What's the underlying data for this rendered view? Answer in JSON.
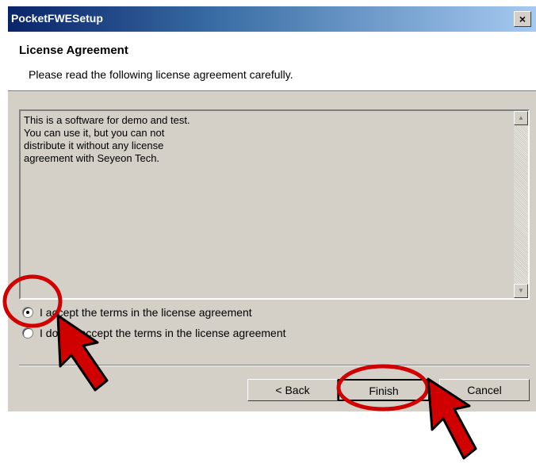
{
  "window": {
    "title": "PocketFWESetup",
    "close_glyph": "×"
  },
  "header": {
    "title": "License Agreement",
    "subtitle": "Please read the following license agreement carefully."
  },
  "license": {
    "text": "This is a software for demo and test.\nYou can use it, but you can not\ndistribute it without any license\nagreement with Seyeon Tech.",
    "scroll_up_glyph": "▲",
    "scroll_down_glyph": "▼"
  },
  "options": [
    {
      "label": "I accept the terms in the license agreement",
      "checked": true
    },
    {
      "label": "I do not accept the terms in the license agreement",
      "checked": false
    }
  ],
  "buttons": {
    "back": "< Back",
    "finish": "Finish",
    "cancel": "Cancel"
  },
  "annotations": {
    "color": "#d00000",
    "circles": [
      "accept-radio",
      "finish-button"
    ],
    "arrows": [
      "accept-radio",
      "finish-button"
    ]
  }
}
